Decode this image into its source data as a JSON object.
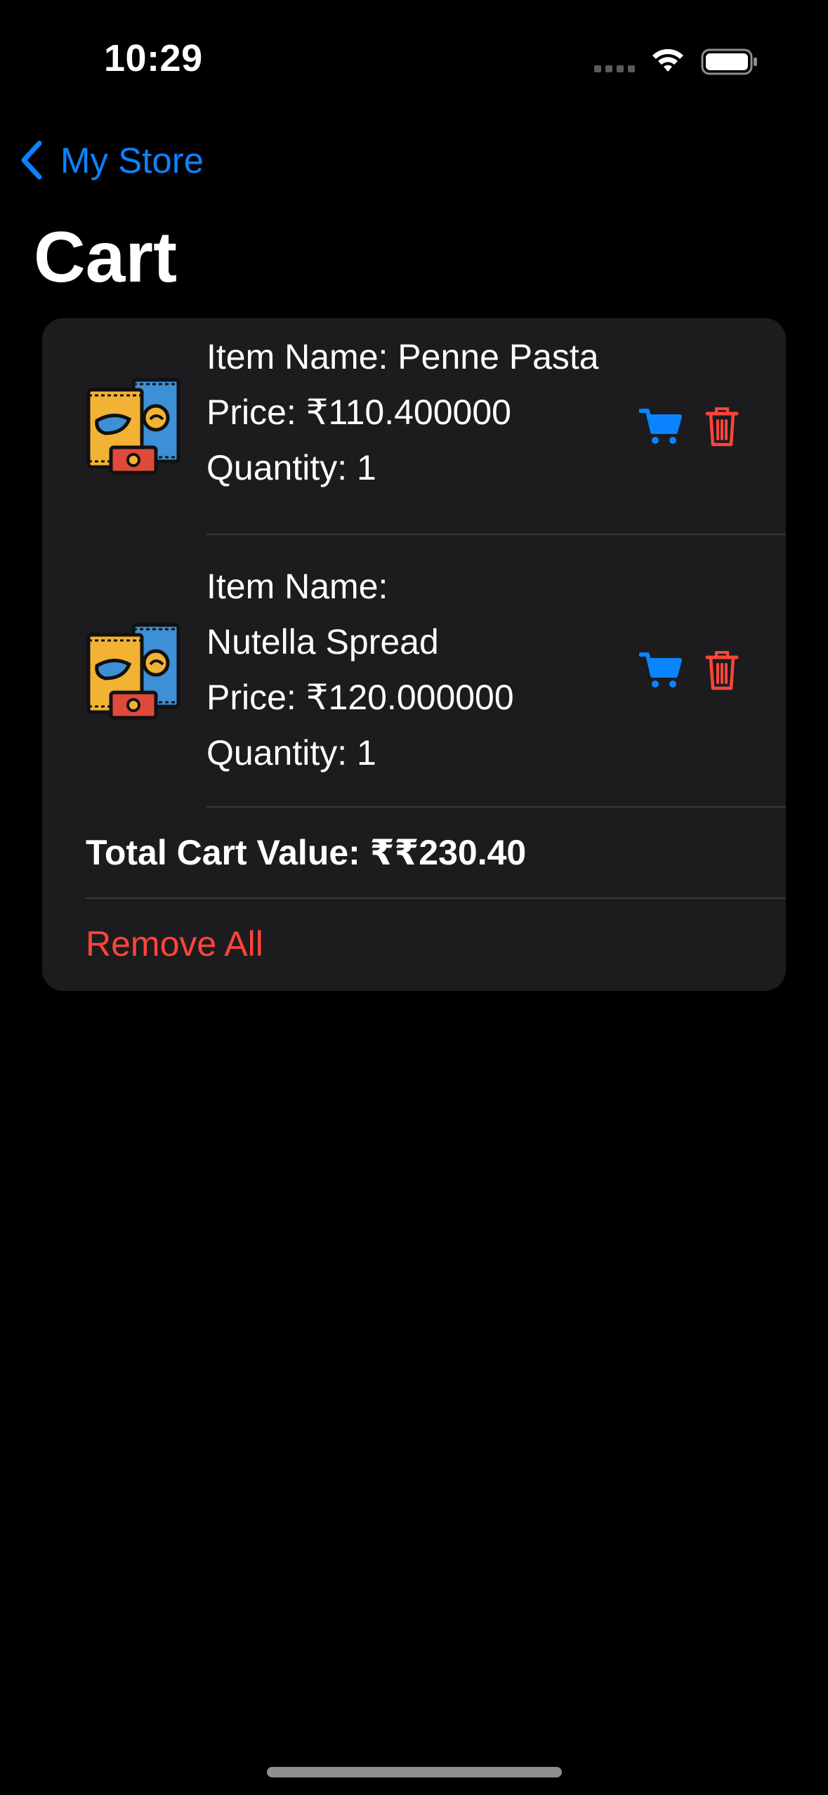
{
  "status_bar": {
    "time": "10:29"
  },
  "nav": {
    "back_label": "My Store"
  },
  "page": {
    "title": "Cart"
  },
  "cart": {
    "items": [
      {
        "name_line": "Item Name: Penne Pasta",
        "price_line": "Price: ₹110.400000",
        "quantity_line": "Quantity: 1",
        "icon": "snack-packs-icon"
      },
      {
        "name_label": "Item Name:",
        "name_value": "Nutella Spread",
        "price_line": "Price: ₹120.000000",
        "quantity_line": "Quantity: 1",
        "icon": "snack-packs-icon"
      }
    ],
    "total_line": "Total Cart Value: ₹₹230.40",
    "remove_all_label": "Remove All"
  },
  "colors": {
    "background": "#000000",
    "card": "#1c1c1e",
    "accent_blue": "#0a84ff",
    "destructive_red": "#ff453a",
    "divider": "#38383a"
  }
}
